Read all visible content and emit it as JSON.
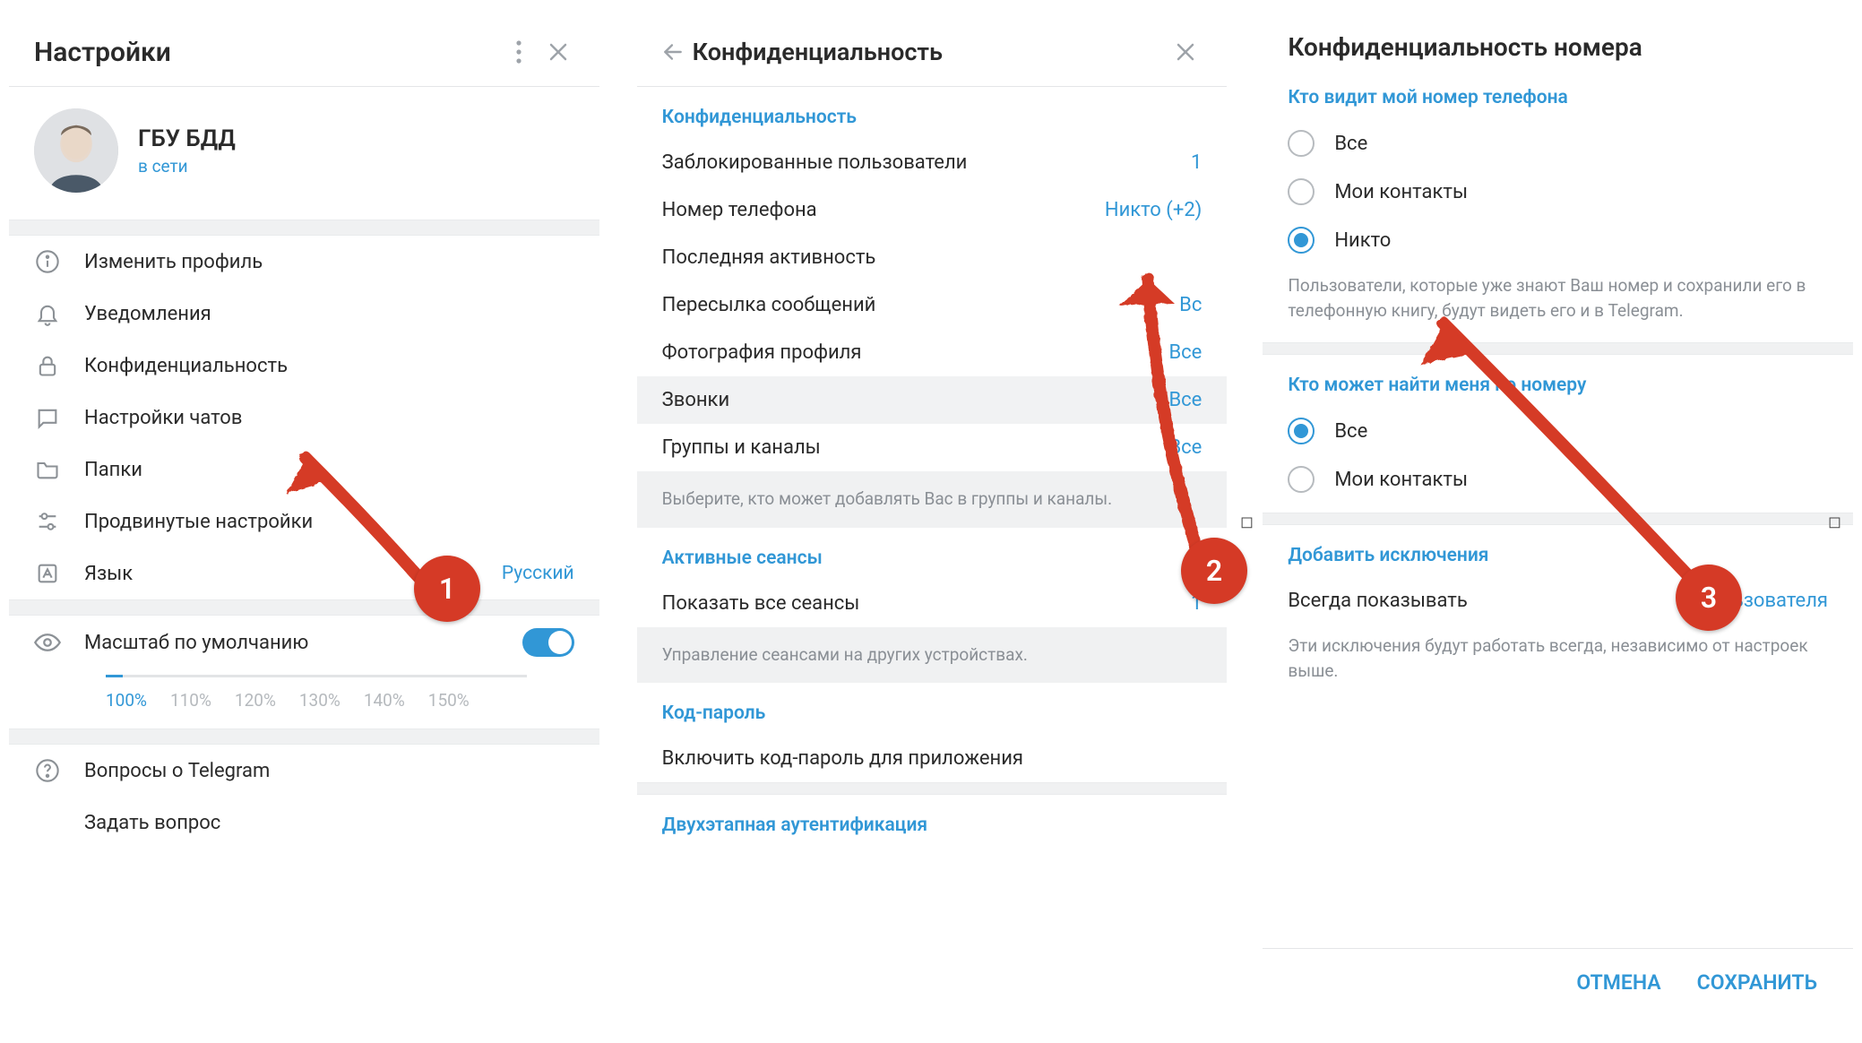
{
  "panel1": {
    "title": "Настройки",
    "profile": {
      "name": "ГБУ БДД",
      "status": "в сети"
    },
    "menu": [
      {
        "key": "edit-profile",
        "icon": "info",
        "label": "Изменить профиль"
      },
      {
        "key": "notifications",
        "icon": "bell",
        "label": "Уведомления"
      },
      {
        "key": "privacy",
        "icon": "lock",
        "label": "Конфиденциальность"
      },
      {
        "key": "chat-settings",
        "icon": "chat",
        "label": "Настройки чатов"
      },
      {
        "key": "folders",
        "icon": "folder",
        "label": "Папки"
      },
      {
        "key": "advanced",
        "icon": "sliders",
        "label": "Продвинутые настройки"
      },
      {
        "key": "language",
        "icon": "lang",
        "label": "Язык",
        "value": "Русский"
      }
    ],
    "zoom": {
      "label": "Масштаб по умолчанию",
      "values": [
        "100%",
        "110%",
        "120%",
        "130%",
        "140%",
        "150%"
      ]
    },
    "help": [
      {
        "key": "faq",
        "label": "Вопросы о Telegram"
      },
      {
        "key": "ask",
        "label": "Задать вопрос"
      }
    ]
  },
  "panel2": {
    "title": "Конфиденциальность",
    "sec_privacy": "Конфиденциальность",
    "rows": [
      {
        "key": "blocked",
        "label": "Заблокированные пользователи",
        "value": "1"
      },
      {
        "key": "phone",
        "label": "Номер телефона",
        "value": "Никто (+2)"
      },
      {
        "key": "lastseen",
        "label": "Последняя активность",
        "value": ""
      },
      {
        "key": "forward",
        "label": "Пересылка сообщений",
        "value": "Вс"
      },
      {
        "key": "photo",
        "label": "Фотография профиля",
        "value": "Все"
      },
      {
        "key": "calls",
        "label": "Звонки",
        "value": "Все"
      },
      {
        "key": "groups",
        "label": "Группы и каналы",
        "value": "Все"
      }
    ],
    "groups_note": "Выберите, кто может добавлять Вас в группы и каналы.",
    "sec_sessions": "Активные сеансы",
    "sessions_row": {
      "label": "Показать все сеансы",
      "value": "1"
    },
    "sessions_note": "Управление сеансами на других устройствах.",
    "sec_pass": "Код-пароль",
    "pass_row": "Включить код-пароль для приложения",
    "sec_2fa": "Двухэтапная аутентификация"
  },
  "panel3": {
    "title": "Конфиденциальность номера",
    "sec_who_sees": "Кто видит мой номер телефона",
    "opts_see": [
      {
        "key": "all",
        "label": "Все",
        "checked": false
      },
      {
        "key": "contacts",
        "label": "Мои контакты",
        "checked": false
      },
      {
        "key": "nobody",
        "label": "Никто",
        "checked": true
      }
    ],
    "see_note": "Пользователи, которые уже знают Ваш номер и сохранили его в телефонную книгу, будут видеть его и в Telegram.",
    "sec_who_finds": "Кто может найти меня по номеру",
    "opts_find": [
      {
        "key": "all",
        "label": "Все",
        "checked": true
      },
      {
        "key": "contacts",
        "label": "Мои контакты",
        "checked": false
      }
    ],
    "sec_exceptions": "Добавить исключения",
    "exc_row": {
      "label": "Всегда показывать",
      "value": "2 пользователя"
    },
    "exc_note": "Эти исключения будут работать всегда, независимо от настроек выше.",
    "btn_cancel": "ОТМЕНА",
    "btn_save": "СОХРАНИТЬ"
  },
  "annotations": {
    "n1": "1",
    "n2": "2",
    "n3": "3"
  }
}
